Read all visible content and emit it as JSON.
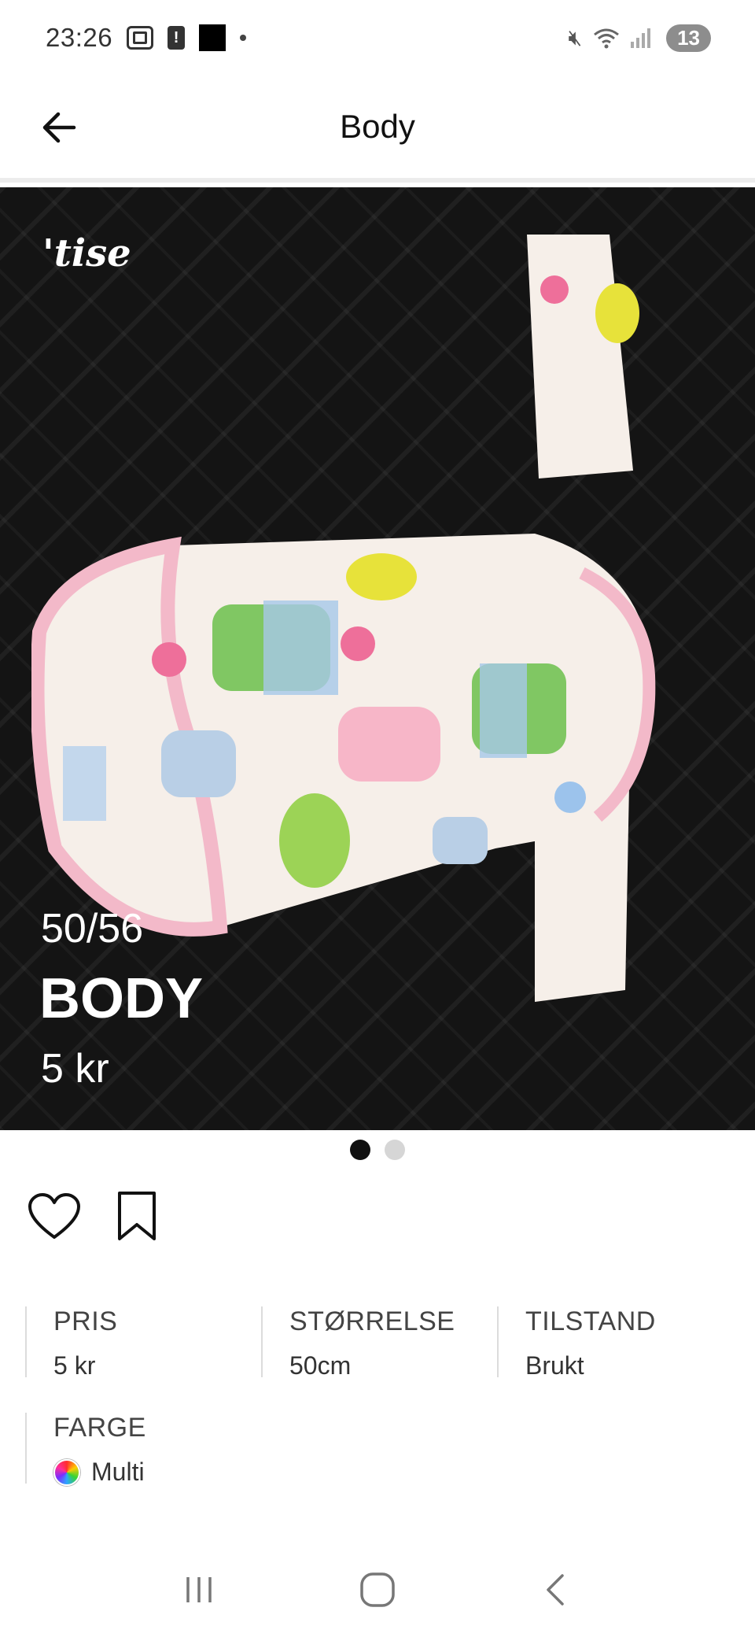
{
  "status_bar": {
    "time": "23:26",
    "left_icons": [
      "screenshot-icon",
      "alert-icon",
      "app-thumbnail-icon",
      "notification-dot-icon"
    ],
    "right_icons": [
      "mute-icon",
      "wifi-icon",
      "signal-icon"
    ],
    "notification_count": "13"
  },
  "header": {
    "title": "Body",
    "back_icon": "arrow-left-icon"
  },
  "hero": {
    "brand_watermark": "'tise",
    "overlay_size": "50/56",
    "overlay_name": "BODY",
    "overlay_price": "5 kr"
  },
  "carousel": {
    "total": 2,
    "active_index": 0
  },
  "actions": {
    "like_icon": "heart-icon",
    "save_icon": "bookmark-icon"
  },
  "details": {
    "price": {
      "label": "PRIS",
      "value": "5 kr"
    },
    "size": {
      "label": "STØRRELSE",
      "value": "50cm"
    },
    "condition": {
      "label": "TILSTAND",
      "value": "Brukt"
    },
    "color": {
      "label": "FARGE",
      "value": "Multi"
    }
  },
  "nav": {
    "recents_icon": "recents-icon",
    "home_icon": "home-icon",
    "back_icon": "back-chevron-icon"
  },
  "colors": {
    "hero_background": "#141414",
    "bodysuit_fabric": "#f6efe9",
    "bodysuit_trim": "#f3b9c9",
    "active_dot": "#111111",
    "inactive_dot": "#d6d6d6"
  }
}
